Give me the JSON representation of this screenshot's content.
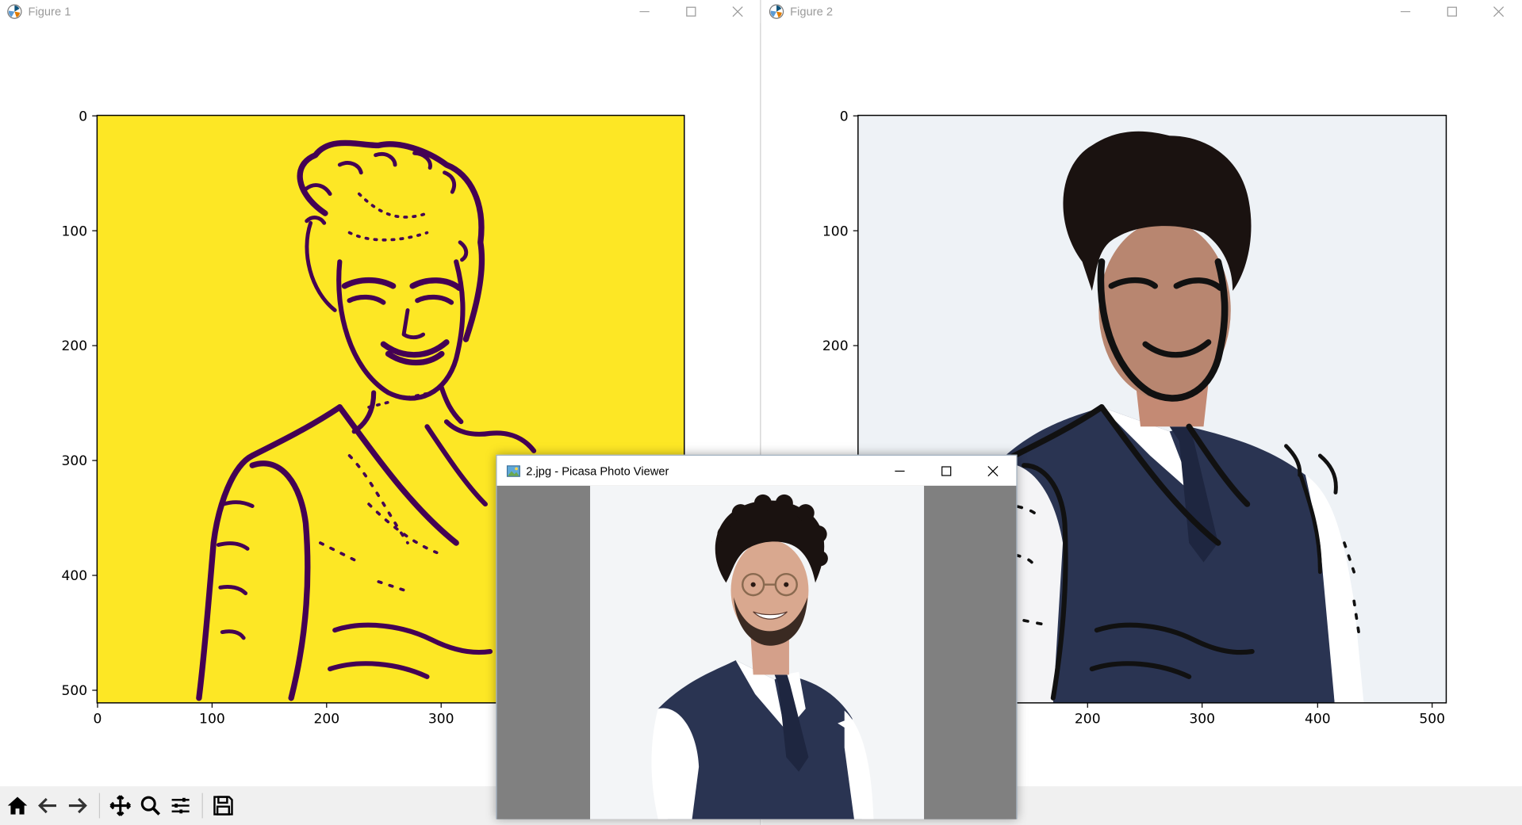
{
  "figure1": {
    "title": "Figure 1",
    "y_ticks": [
      "0",
      "100",
      "200",
      "300",
      "400",
      "500"
    ],
    "x_ticks": [
      "0",
      "100",
      "200",
      "300"
    ]
  },
  "figure2": {
    "title": "Figure 2",
    "y_ticks": [
      "0",
      "100",
      "200"
    ],
    "x_ticks": [
      "200",
      "300",
      "400",
      "500"
    ]
  },
  "toolbar": {
    "buttons": [
      "home-icon",
      "back-arrow-icon",
      "forward-arrow-icon",
      "pan-icon",
      "zoom-icon",
      "configure-subplots-icon",
      "save-icon"
    ]
  },
  "picasa": {
    "title": "2.jpg - Picasa Photo Viewer"
  },
  "colors": {
    "viridis_yellow": "#fde725",
    "viridis_purple": "#440154",
    "cartoon_bg": "#eef2f6",
    "suit_navy": "#2a3452",
    "viewer_gray": "#808080"
  }
}
